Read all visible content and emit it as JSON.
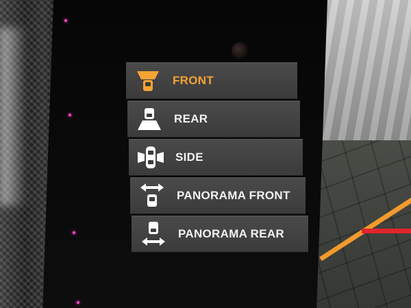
{
  "menu": {
    "items": [
      {
        "label": "FRONT",
        "icon": "front-camera-icon",
        "selected": true
      },
      {
        "label": "REAR",
        "icon": "rear-camera-icon",
        "selected": false
      },
      {
        "label": "SIDE",
        "icon": "side-camera-icon",
        "selected": false
      },
      {
        "label": "PANORAMA FRONT",
        "icon": "panorama-front-icon",
        "selected": false
      },
      {
        "label": "PANORAMA REAR",
        "icon": "panorama-rear-icon",
        "selected": false
      }
    ]
  },
  "colors": {
    "accent": "#f5a334",
    "text": "#f2f2f2",
    "item_bg": "#434343",
    "guide_orange": "#f29a2e",
    "guide_red": "#e0252c"
  }
}
